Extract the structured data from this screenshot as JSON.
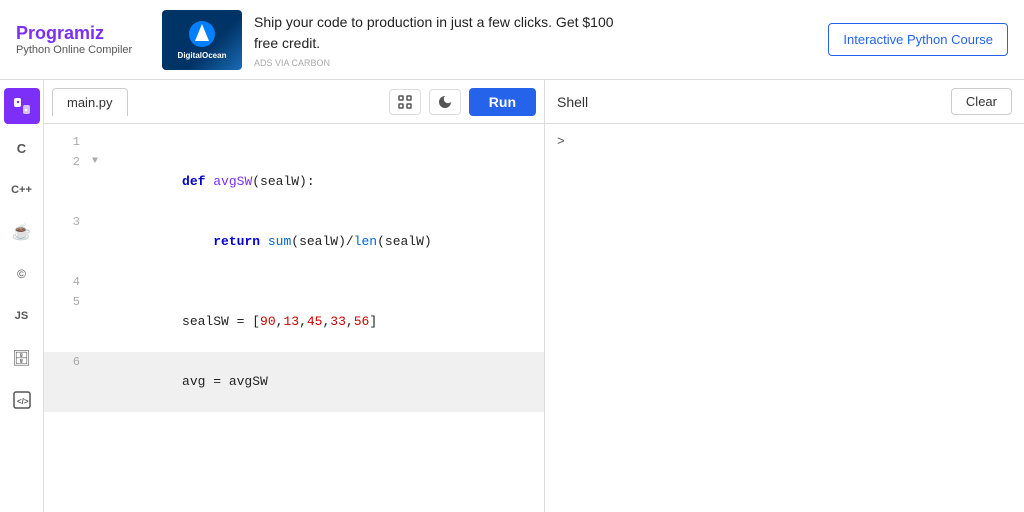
{
  "topbar": {
    "logo_name": "Programiz",
    "logo_subtitle": "Python Online Compiler",
    "ad_text": "Ship your code to production in just a few clicks. Get $100\nfree credit.",
    "ad_label": "ADS VIA CARBON",
    "ad_image_text": "DigitalOcean",
    "cta_label": "Interactive Python Course"
  },
  "sidebar": {
    "icons": [
      {
        "name": "python-icon",
        "symbol": "🐍",
        "active": true
      },
      {
        "name": "c-icon",
        "symbol": "C",
        "active": false
      },
      {
        "name": "cpp-icon",
        "symbol": "C++",
        "active": false
      },
      {
        "name": "java-icon",
        "symbol": "☕",
        "active": false
      },
      {
        "name": "c-lang-icon",
        "symbol": "©",
        "active": false
      },
      {
        "name": "js-icon",
        "symbol": "JS",
        "active": false
      },
      {
        "name": "db-icon",
        "symbol": "🗄",
        "active": false
      },
      {
        "name": "html-icon",
        "symbol": "🌐",
        "active": false
      }
    ]
  },
  "editor": {
    "tab_label": "main.py",
    "fullscreen_title": "Fullscreen",
    "theme_title": "Toggle theme",
    "run_label": "Run",
    "code_lines": [
      {
        "num": "1",
        "arrow": " ",
        "content": "",
        "highlighted": false
      },
      {
        "num": "2",
        "arrow": "▼",
        "content": "def avgSW(sealW):",
        "highlighted": false
      },
      {
        "num": "3",
        "arrow": " ",
        "content": "    return sum(sealW)/len(sealW)",
        "highlighted": false
      },
      {
        "num": "4",
        "arrow": " ",
        "content": "",
        "highlighted": false
      },
      {
        "num": "5",
        "arrow": " ",
        "content": "sealSW = [90,13,45,33,56]",
        "highlighted": false
      },
      {
        "num": "6",
        "arrow": " ",
        "content": "avg = avgSW",
        "highlighted": true
      }
    ]
  },
  "shell": {
    "label": "Shell",
    "clear_label": "Clear",
    "prompt": ">"
  }
}
